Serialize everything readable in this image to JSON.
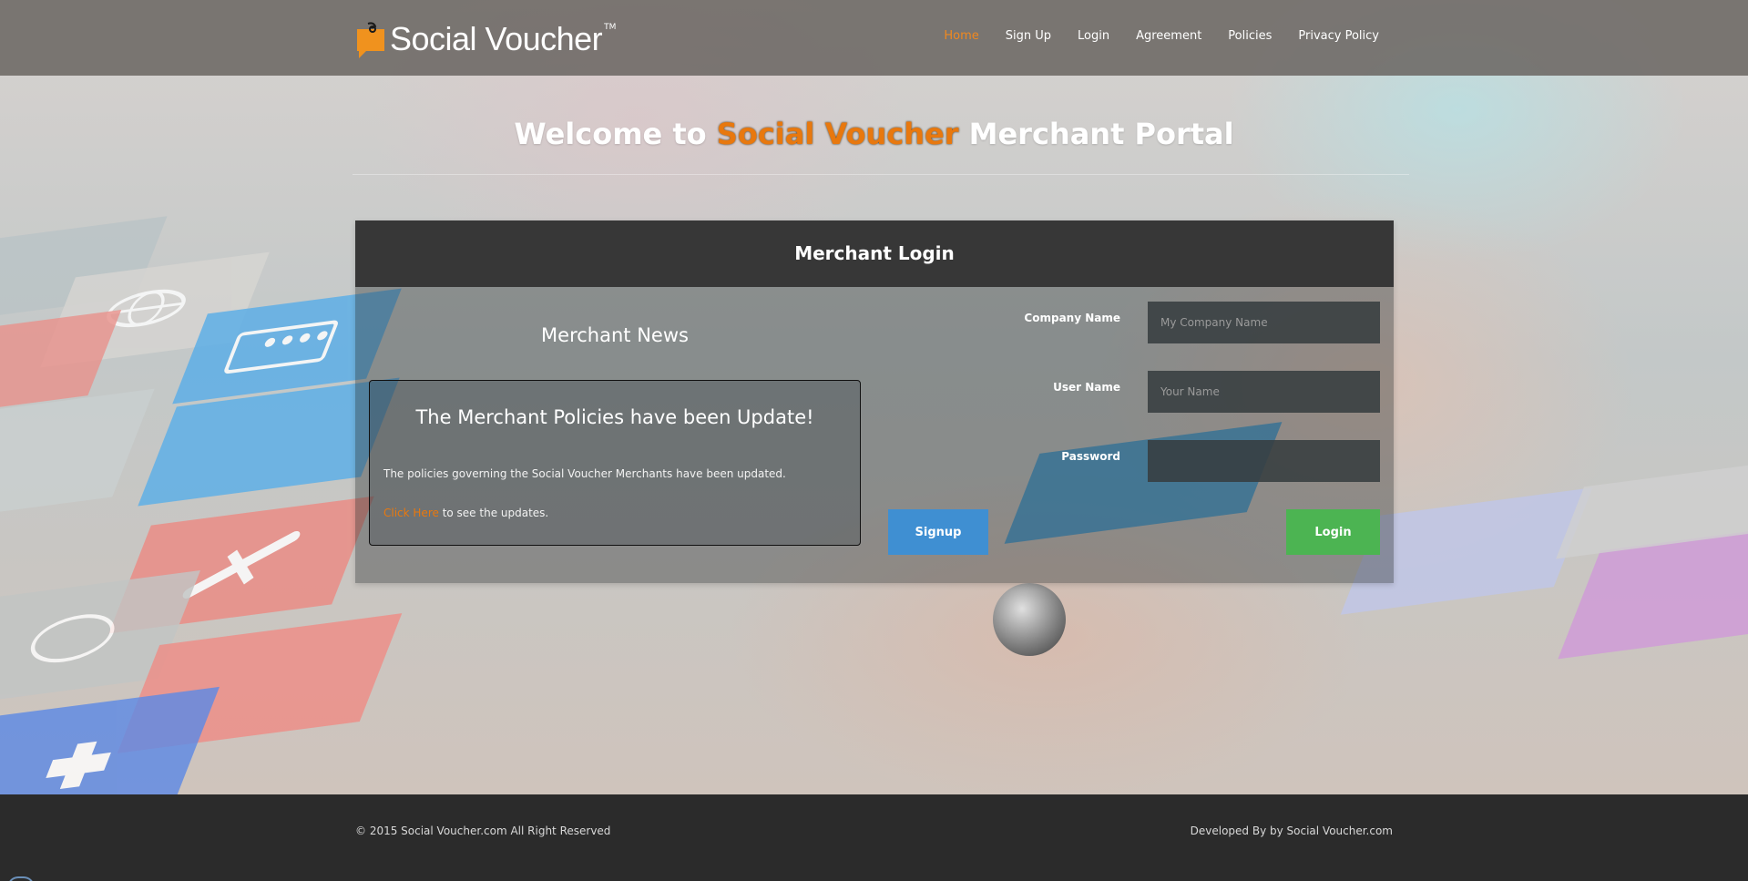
{
  "brand": {
    "name": "Social Voucher",
    "trademark": "TM",
    "logo_icon": "speech-bubble-logo-icon",
    "accent_color": "#e8780e"
  },
  "nav": {
    "items": [
      {
        "label": "Home",
        "active": true
      },
      {
        "label": "Sign Up",
        "active": false
      },
      {
        "label": "Login",
        "active": false
      },
      {
        "label": "Agreement",
        "active": false
      },
      {
        "label": "Policies",
        "active": false
      },
      {
        "label": "Privacy Policy",
        "active": false
      }
    ]
  },
  "welcome": {
    "prefix": "Welcome to ",
    "brand": "Social Voucher",
    "suffix": " Merchant Portal"
  },
  "panel": {
    "title": "Merchant Login",
    "news": {
      "title": "Merchant News",
      "headline": "The Merchant Policies have been Update!",
      "body": "The policies governing the Social Voucher Merchants have been updated.",
      "link_text": "Click Here",
      "link_suffix": " to see the updates."
    },
    "form": {
      "company_label": "Company Name",
      "company_placeholder": "My Company Name",
      "company_value": "",
      "user_label": "User Name",
      "user_placeholder": "Your Name",
      "user_value": "",
      "password_label": "Password",
      "password_value": "",
      "signup_label": "Signup",
      "login_label": "Login",
      "signup_color": "#3f8fd2",
      "login_color": "#4cb452"
    }
  },
  "footer": {
    "copyright": "© 2015 Social Voucher.com All Right Reserved",
    "developer": "Developed By by Social Voucher.com"
  }
}
